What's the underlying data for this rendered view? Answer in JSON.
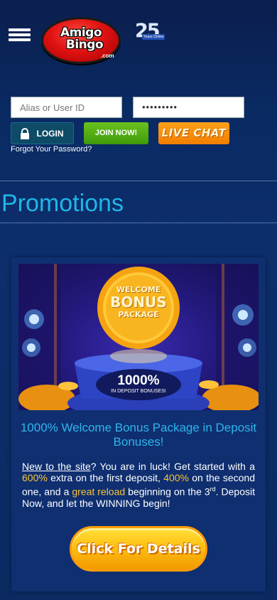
{
  "header": {
    "menu_icon": "hamburger-menu-icon",
    "logo": {
      "line1": "Amigo",
      "line2": "Bingo",
      "suffix": ".com"
    },
    "anniversary": {
      "number": "25",
      "sub": "Years Online"
    }
  },
  "login": {
    "username_placeholder": "Alias or User ID",
    "password_value": "•••••••••",
    "login_label": "LOGIN",
    "join_label": "JOIN NOW!",
    "chat_label": "LIVE CHAT",
    "forgot_label": "Forgot Your Password?"
  },
  "page": {
    "title": "Promotions"
  },
  "promo": {
    "banner": {
      "coin_line1": "WELCOME",
      "coin_line2": "BONUS",
      "coin_line3": "PACKAGE",
      "pedestal_big": "1000%",
      "pedestal_small": "IN DEPOSIT BONUSES!"
    },
    "title": "1000% Welcome Bonus Package in Deposit Bonuses!",
    "body": {
      "link": "New to the site",
      "t1": "? You are in luck! Get started with a ",
      "h1": "600%",
      "t2": " extra on the first deposit, ",
      "h2": "400%",
      "t3": " on the second one, and a ",
      "h3": "great reload",
      "t4": " beginning on the 3",
      "sup": "rd",
      "t5": ". Deposit Now, and let the WINNING begin!"
    },
    "button_label": "Click For Details"
  },
  "colors": {
    "background": "#0b2a62",
    "accent_blue": "#1fb6e8",
    "highlight": "#f7c33a",
    "join_green": "#4fac12",
    "chat_orange": "#f78c00"
  }
}
